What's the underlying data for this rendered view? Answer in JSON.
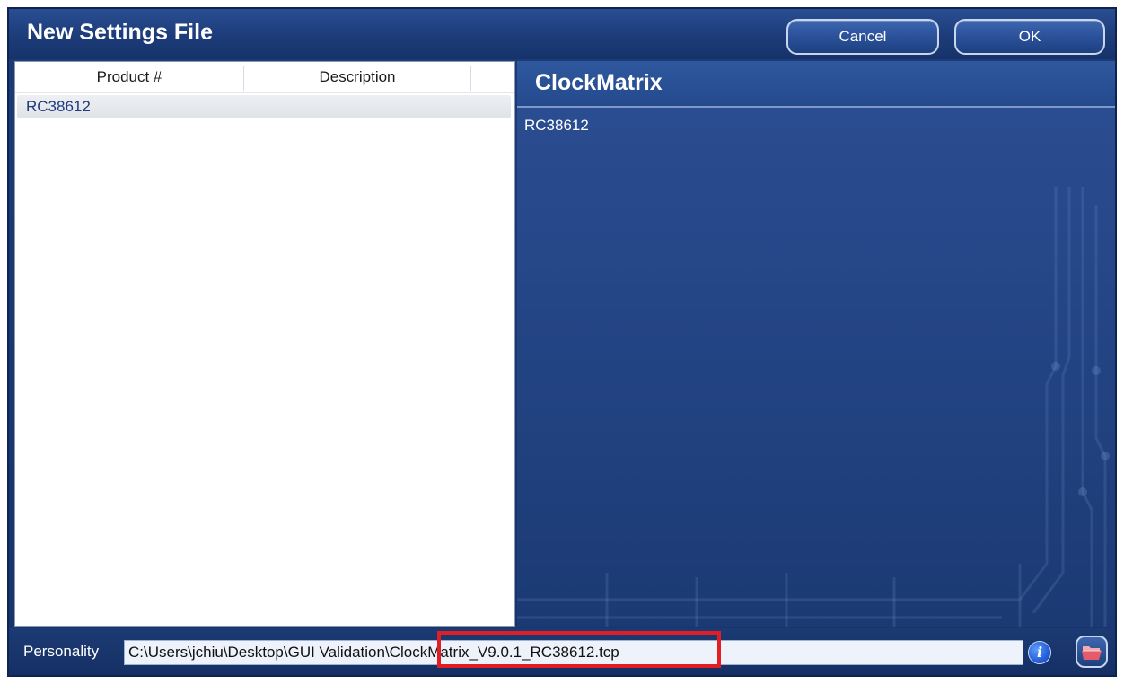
{
  "window": {
    "title": "New Settings File"
  },
  "actions": {
    "cancel_label": "Cancel",
    "ok_label": "OK"
  },
  "product_table": {
    "headers": [
      "Product #",
      "Description"
    ],
    "rows": [
      {
        "product": "RC38612",
        "description": ""
      }
    ]
  },
  "details": {
    "family": "ClockMatrix",
    "product": "RC38612"
  },
  "personality": {
    "label": "Personality",
    "path": "C:\\Users\\jchiu\\Desktop\\GUI Validation\\ClockMatrix_V9.0.1_RC38612.tcp"
  },
  "icons": {
    "info": "info-icon",
    "folder": "open-folder-icon"
  },
  "colors": {
    "highlight_box": "#e01e24",
    "accent": "#1d3b76"
  }
}
